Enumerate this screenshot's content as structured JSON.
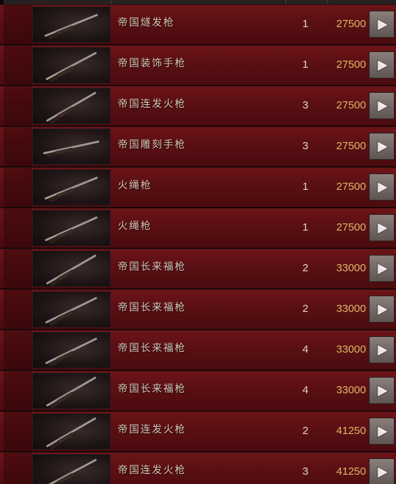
{
  "listing": {
    "rows": [
      {
        "name": "帝国燧发枪",
        "qty": "1",
        "price": "27500",
        "weapon_icon": "flintlock-rifle-icon"
      },
      {
        "name": "帝国装饰手枪",
        "qty": "1",
        "price": "27500",
        "weapon_icon": "ornate-pistol-icon"
      },
      {
        "name": "帝国连发火枪",
        "qty": "3",
        "price": "27500",
        "weapon_icon": "repeater-musket-icon"
      },
      {
        "name": "帝国雕刻手枪",
        "qty": "3",
        "price": "27500",
        "weapon_icon": "engraved-pistol-icon"
      },
      {
        "name": "火绳枪",
        "qty": "1",
        "price": "27500",
        "weapon_icon": "matchlock-icon"
      },
      {
        "name": "火绳枪",
        "qty": "1",
        "price": "27500",
        "weapon_icon": "matchlock-icon"
      },
      {
        "name": "帝国长来福枪",
        "qty": "2",
        "price": "33000",
        "weapon_icon": "long-rifle-icon"
      },
      {
        "name": "帝国长来福枪",
        "qty": "2",
        "price": "33000",
        "weapon_icon": "long-rifle-icon"
      },
      {
        "name": "帝国长来福枪",
        "qty": "4",
        "price": "33000",
        "weapon_icon": "long-rifle-icon"
      },
      {
        "name": "帝国长来福枪",
        "qty": "4",
        "price": "33000",
        "weapon_icon": "long-rifle-icon"
      },
      {
        "name": "帝国连发火枪",
        "qty": "2",
        "price": "41250",
        "weapon_icon": "repeater-musket-icon"
      },
      {
        "name": "帝国连发火枪",
        "qty": "3",
        "price": "41250",
        "weapon_icon": "repeater-musket-icon"
      }
    ]
  },
  "colors": {
    "row_red": "#5a0f13",
    "price_gold": "#e0b865",
    "name_text": "#d8c7b8",
    "button_grey": "#7a706c"
  },
  "icons": {
    "buy_button": "play-arrow-icon"
  }
}
